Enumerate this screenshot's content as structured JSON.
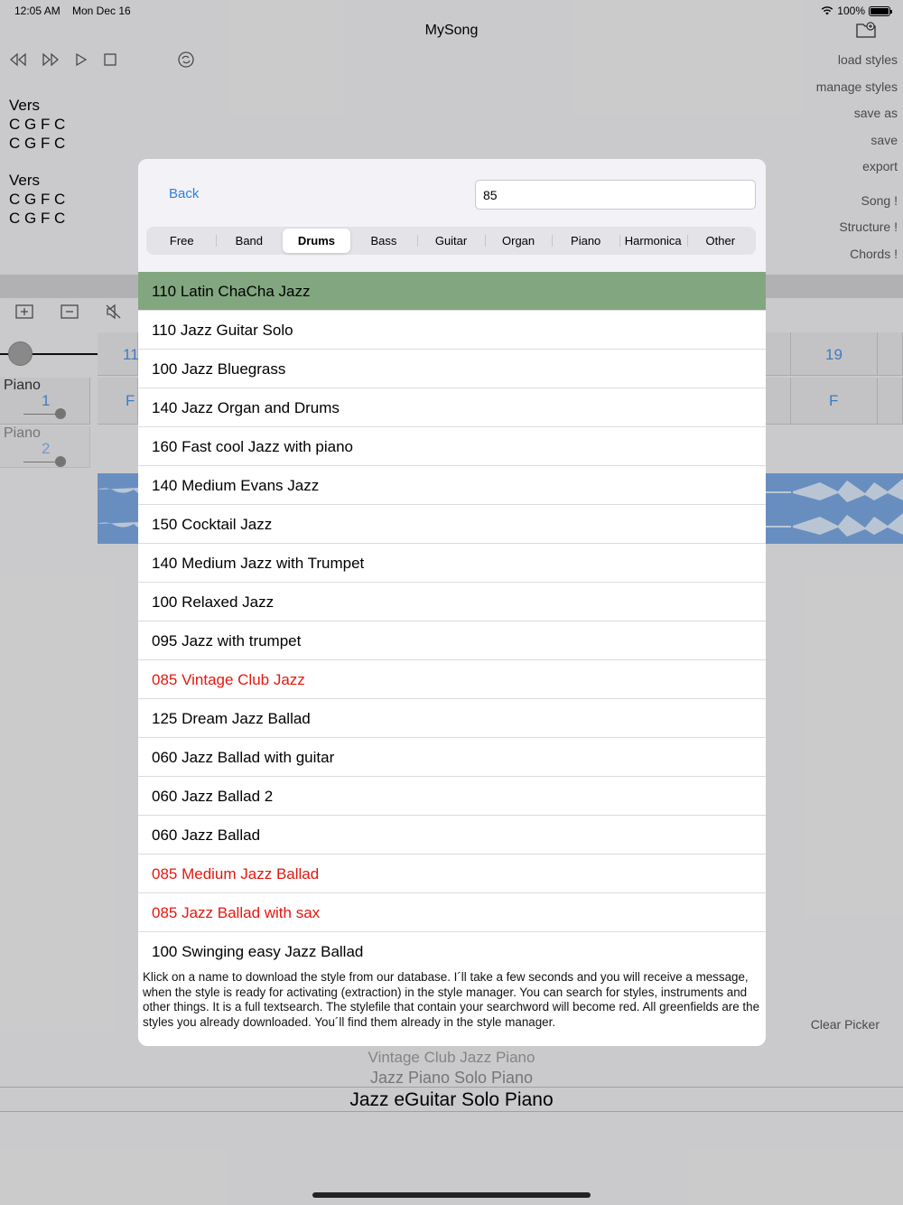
{
  "status_bar": {
    "time": "12:05 AM",
    "date": "Mon Dec 16",
    "battery": "100%"
  },
  "app": {
    "title": "MySong"
  },
  "side_menu": [
    "load styles",
    "manage styles",
    "save as",
    "save",
    "export",
    "Song !",
    "Structure !",
    "Chords !"
  ],
  "song_text": [
    {
      "heading": "Vers",
      "lines": [
        "C G F C",
        "C G F C"
      ]
    },
    {
      "heading": "Vers",
      "lines": [
        "C G F C",
        "C G F C"
      ]
    }
  ],
  "tracks": {
    "instruments": [
      {
        "name": "Piano",
        "number": "1"
      },
      {
        "name": "Piano",
        "number": "2"
      }
    ],
    "bar_left": "11",
    "bar_right": "19",
    "chord_left": "F",
    "chord_right": "F"
  },
  "clear_picker": "Clear Picker",
  "picker": {
    "items_above": [
      "Vintage Club Jazz Piano",
      "Jazz Piano Solo Piano"
    ],
    "selected": "Jazz eGuitar Solo Piano"
  },
  "modal": {
    "back_label": "Back",
    "search_value": "85",
    "tabs": [
      "Free",
      "Band",
      "Drums",
      "Bass",
      "Guitar",
      "Organ",
      "Piano",
      "Harmonica",
      "Other"
    ],
    "active_tab": "Drums",
    "styles": [
      {
        "name": "110 Latin ChaCha Jazz",
        "state": "downloaded"
      },
      {
        "name": "110 Jazz Guitar Solo",
        "state": "normal"
      },
      {
        "name": "100 Jazz Bluegrass",
        "state": "normal"
      },
      {
        "name": "140 Jazz Organ and Drums",
        "state": "normal"
      },
      {
        "name": "160 Fast cool Jazz with piano",
        "state": "normal"
      },
      {
        "name": "140 Medium Evans Jazz",
        "state": "normal"
      },
      {
        "name": "150 Cocktail Jazz",
        "state": "normal"
      },
      {
        "name": "140 Medium Jazz with Trumpet",
        "state": "normal"
      },
      {
        "name": "100 Relaxed Jazz",
        "state": "normal"
      },
      {
        "name": "095 Jazz with trumpet",
        "state": "normal"
      },
      {
        "name": "085 Vintage Club Jazz",
        "state": "match"
      },
      {
        "name": "125 Dream Jazz Ballad",
        "state": "normal"
      },
      {
        "name": "060 Jazz Ballad with guitar",
        "state": "normal"
      },
      {
        "name": "060 Jazz Ballad 2",
        "state": "normal"
      },
      {
        "name": "060 Jazz Ballad",
        "state": "normal"
      },
      {
        "name": "085 Medium Jazz Ballad",
        "state": "match"
      },
      {
        "name": "085 Jazz Ballad with sax",
        "state": "match"
      },
      {
        "name": "100 Swinging easy Jazz Ballad",
        "state": "normal"
      }
    ],
    "info_text": "Klick on a name to download the style from our database.  I´ll take a few seconds and you will receive a message, when the style is ready for activating (extraction) in the style manager. You can search for styles, instruments and other things. It is a full textsearch. The stylefile that contain your searchword will become red. All greenfields are the styles you already downloaded. You´ll find them already in the style manager."
  }
}
